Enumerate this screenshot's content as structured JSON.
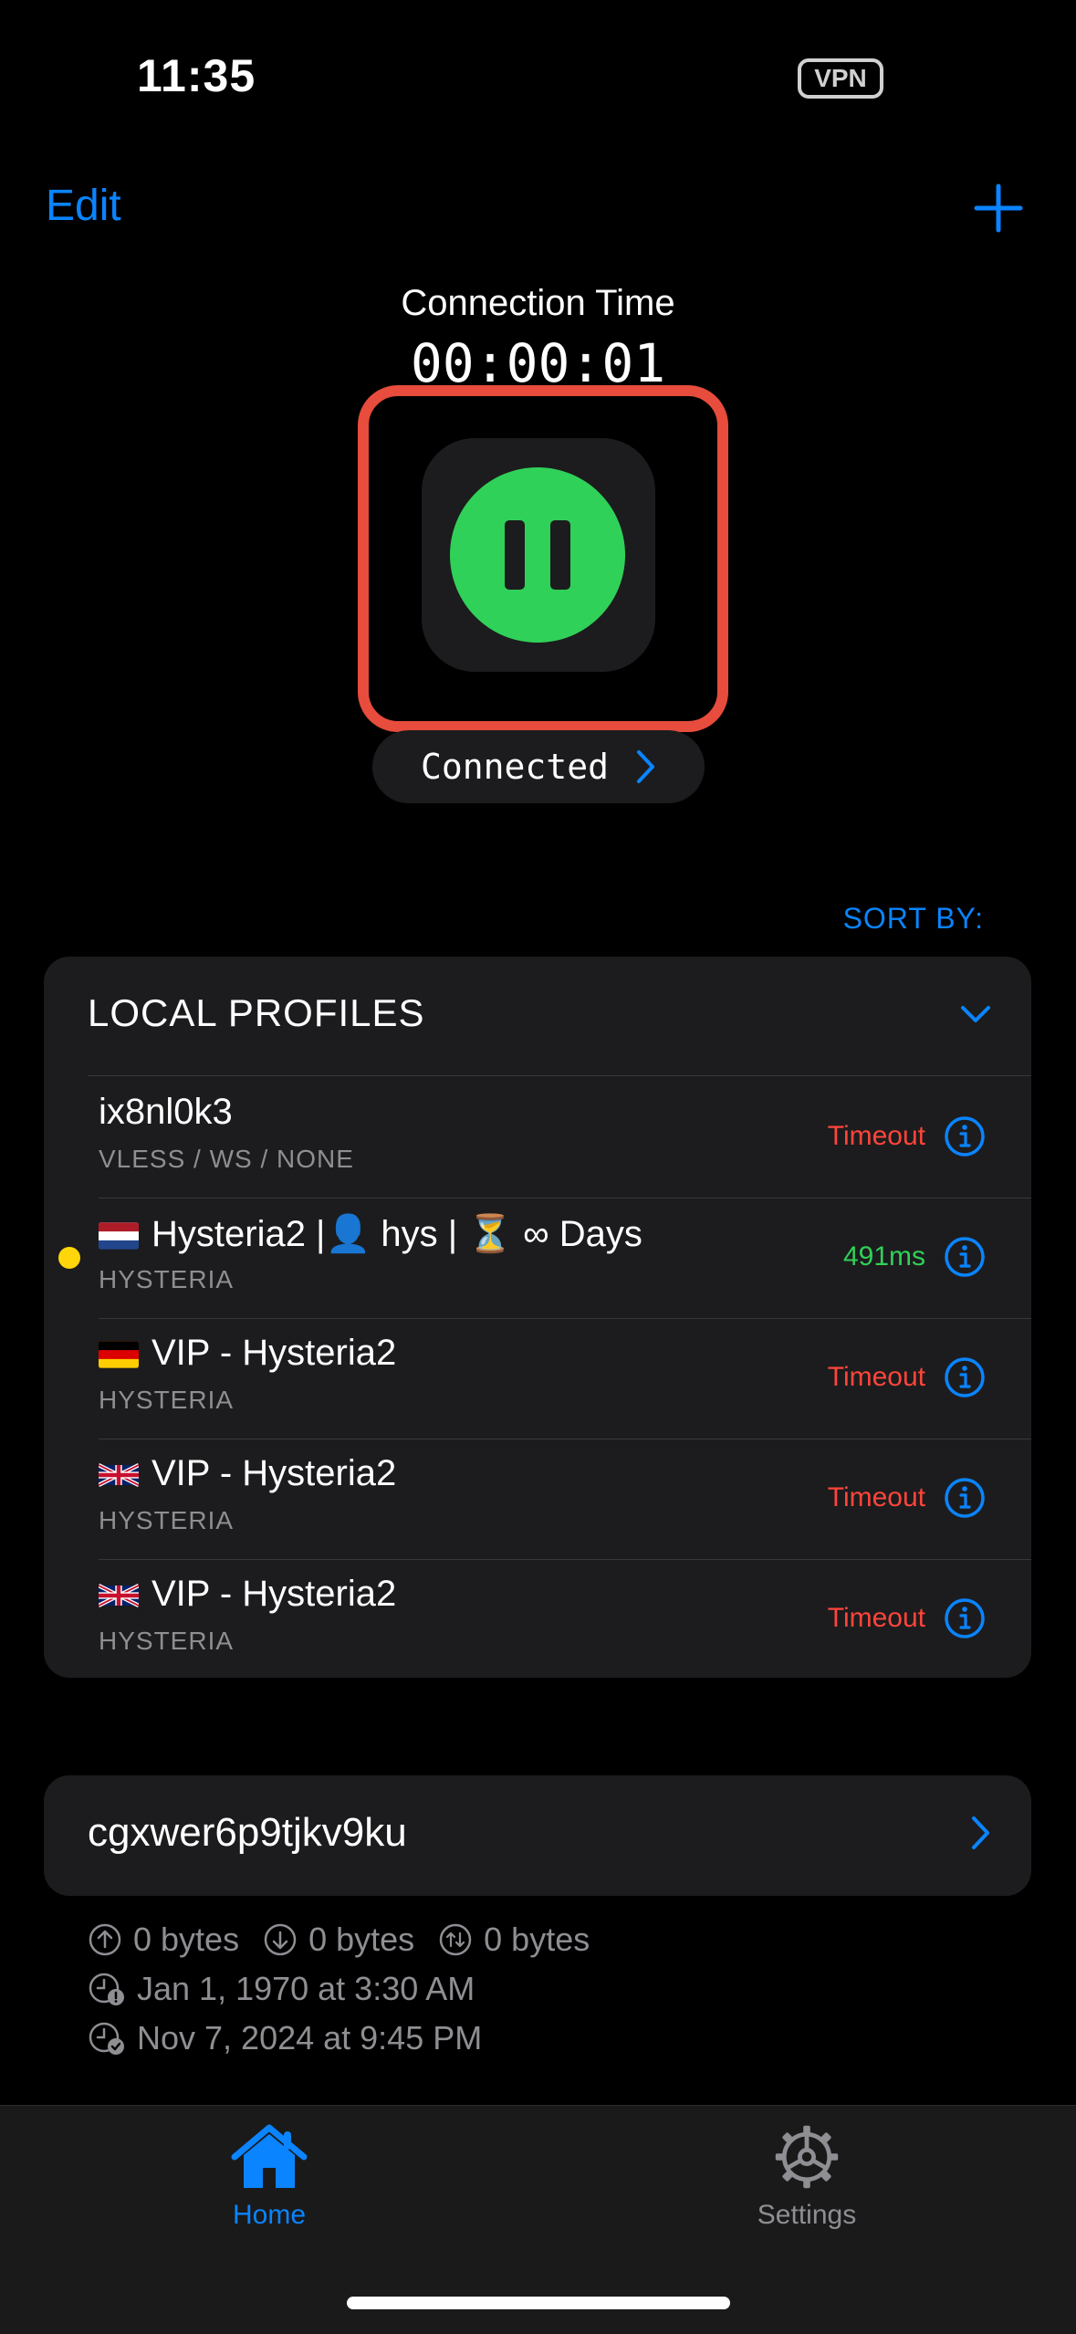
{
  "status_bar": {
    "time": "11:35",
    "vpn": "VPN"
  },
  "nav": {
    "edit": "Edit",
    "add_icon": "plus-icon"
  },
  "connection": {
    "title": "Connection Time",
    "elapsed": "00:00:01",
    "status": "Connected",
    "toggle_icon": "pause-icon"
  },
  "sort": {
    "label": "SORT BY:"
  },
  "profiles": {
    "header": "LOCAL PROFILES",
    "items": [
      {
        "name": "ix8nl0k3",
        "type": "VLESS / WS / NONE",
        "status": "Timeout",
        "flag": ""
      },
      {
        "name": "Hysteria2 |👤 hys | ⏳ ∞ Days",
        "type": "HYSTERIA",
        "status": "491ms",
        "flag": "nl",
        "selected": true
      },
      {
        "name": "VIP - Hysteria2",
        "type": "HYSTERIA",
        "status": "Timeout",
        "flag": "de"
      },
      {
        "name": "VIP - Hysteria2",
        "type": "HYSTERIA",
        "status": "Timeout",
        "flag": "gb"
      },
      {
        "name": "VIP - Hysteria2",
        "type": "HYSTERIA",
        "status": "Timeout",
        "flag": "gb"
      }
    ]
  },
  "subscription": {
    "name": "cgxwer6p9tjkv9ku",
    "upload": "0 bytes",
    "download": "0 bytes",
    "total": "0 bytes",
    "expires": "Jan 1, 1970 at 3:30 AM",
    "updated": "Nov 7, 2024 at 9:45 PM"
  },
  "tabs": [
    {
      "label": "Home",
      "icon": "house-icon",
      "active": true
    },
    {
      "label": "Settings",
      "icon": "gear-icon",
      "active": false
    }
  ],
  "colors": {
    "accent": "#0a84ff",
    "connected": "#30d158",
    "error": "#ff453a",
    "highlight": "#e74c3c"
  }
}
